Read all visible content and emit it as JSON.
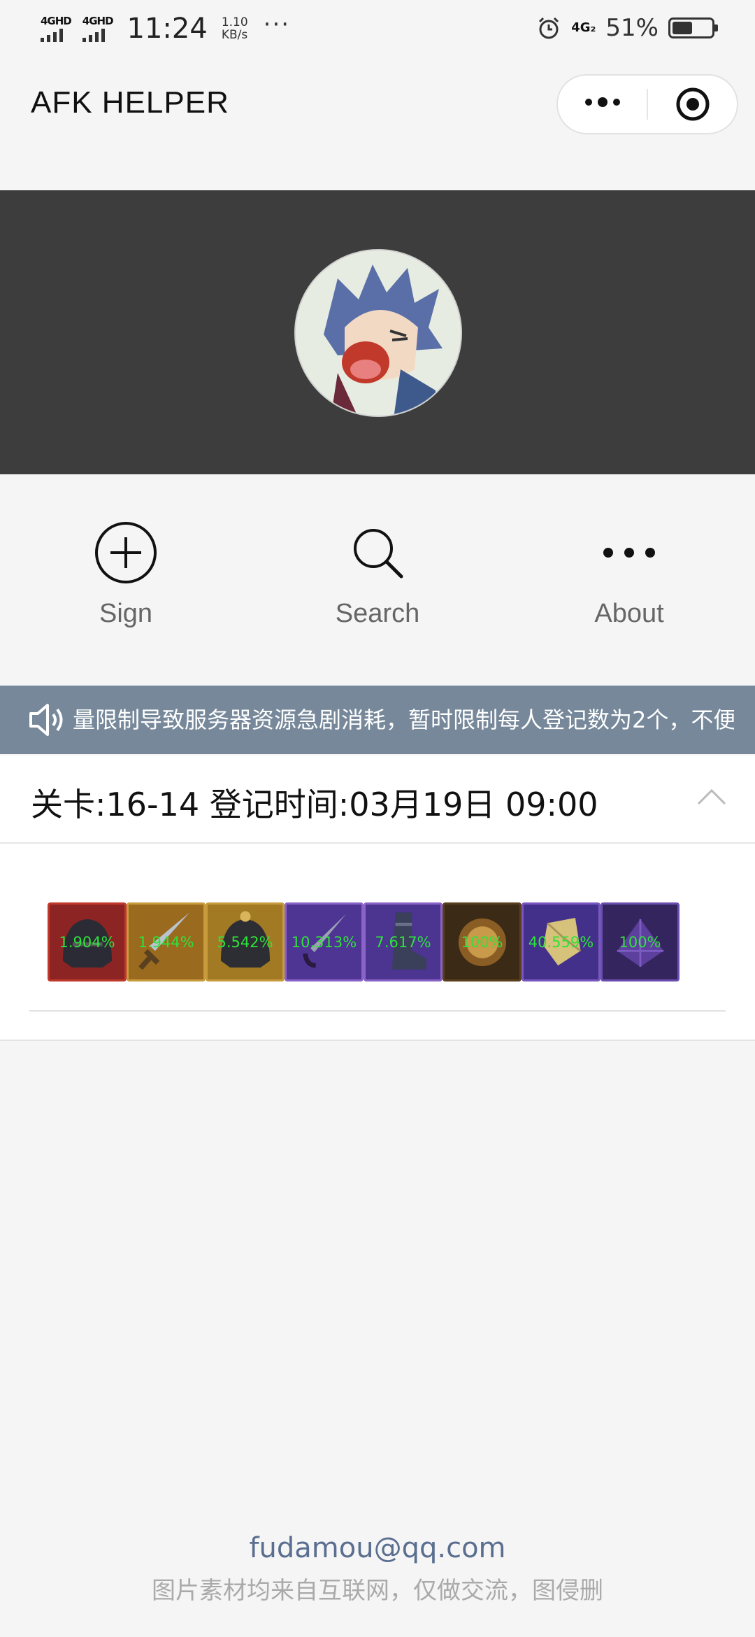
{
  "status_bar": {
    "sim1_label": "4GHD",
    "sim2_label": "4GHD",
    "time": "11:24",
    "net_speed_value": "1.10",
    "net_speed_unit": "KB/s",
    "more_dots": "···",
    "network_label": "4G₂",
    "battery_percent_text": "51%",
    "battery_level": 0.51
  },
  "header": {
    "title": "AFK HELPER",
    "more_icon": "more-dots-icon",
    "close_icon": "target-close-icon"
  },
  "banner": {
    "background_color": "#3d3d3d",
    "avatar_icon": "anime-character-avatar"
  },
  "nav": {
    "items": [
      {
        "label": "Sign",
        "icon": "plus-circle-icon"
      },
      {
        "label": "Search",
        "icon": "search-icon"
      },
      {
        "label": "About",
        "icon": "more-dots-icon"
      }
    ]
  },
  "notice": {
    "icon": "speaker-icon",
    "text": "量限制导致服务器资源急剧消耗，暂时限制每人登记数为2个，不便",
    "background_color": "#76889a"
  },
  "level": {
    "title": "关卡:16-14 登记时间:03月19日 09:00",
    "collapse_icon": "chevron-up-icon",
    "items": [
      {
        "percent": "1.904%",
        "icon": "red-helmet-item"
      },
      {
        "percent": "1.944%",
        "icon": "gold-sword-item"
      },
      {
        "percent": "5.542%",
        "icon": "gold-helmet-item"
      },
      {
        "percent": "10.313%",
        "icon": "purple-sword-item"
      },
      {
        "percent": "7.617%",
        "icon": "purple-boots-item"
      },
      {
        "percent": "100%",
        "icon": "gold-coin-item"
      },
      {
        "percent": "40.559%",
        "icon": "dust-crystal-item"
      },
      {
        "percent": "100%",
        "icon": "purple-gem-item"
      }
    ]
  },
  "footer": {
    "email": "fudamou@qq.com",
    "note": "图片素材均来自互联网，仅做交流，图侵删"
  },
  "colors": {
    "page_bg": "#f5f5f5",
    "percent_text": "#2ee33a",
    "footer_email": "#5a6e90"
  }
}
